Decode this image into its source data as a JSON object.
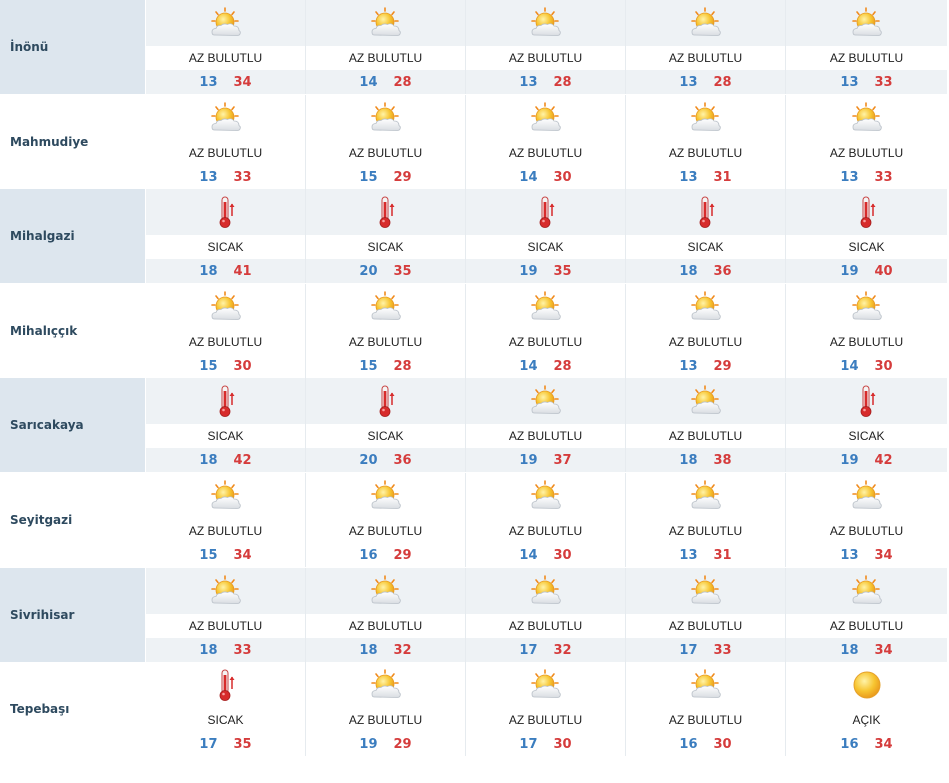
{
  "colors": {
    "min_temp": "#3b7dbf",
    "max_temp": "#d53c3c",
    "label_cell": "#dde6ee",
    "stripe": "#eef2f5"
  },
  "rows": [
    {
      "name": "İnönü",
      "days": [
        {
          "icon": "partly-cloudy-icon",
          "cond": "AZ BULUTLU",
          "min": "13",
          "max": "34"
        },
        {
          "icon": "partly-cloudy-icon",
          "cond": "AZ BULUTLU",
          "min": "14",
          "max": "28"
        },
        {
          "icon": "partly-cloudy-icon",
          "cond": "AZ BULUTLU",
          "min": "13",
          "max": "28"
        },
        {
          "icon": "partly-cloudy-icon",
          "cond": "AZ BULUTLU",
          "min": "13",
          "max": "28"
        },
        {
          "icon": "partly-cloudy-icon",
          "cond": "AZ BULUTLU",
          "min": "13",
          "max": "33"
        }
      ]
    },
    {
      "name": "Mahmudiye",
      "days": [
        {
          "icon": "partly-cloudy-icon",
          "cond": "AZ BULUTLU",
          "min": "13",
          "max": "33"
        },
        {
          "icon": "partly-cloudy-icon",
          "cond": "AZ BULUTLU",
          "min": "15",
          "max": "29"
        },
        {
          "icon": "partly-cloudy-icon",
          "cond": "AZ BULUTLU",
          "min": "14",
          "max": "30"
        },
        {
          "icon": "partly-cloudy-icon",
          "cond": "AZ BULUTLU",
          "min": "13",
          "max": "31"
        },
        {
          "icon": "partly-cloudy-icon",
          "cond": "AZ BULUTLU",
          "min": "13",
          "max": "33"
        }
      ]
    },
    {
      "name": "Mihalgazi",
      "days": [
        {
          "icon": "thermometer-hot-icon",
          "cond": "SICAK",
          "min": "18",
          "max": "41"
        },
        {
          "icon": "thermometer-hot-icon",
          "cond": "SICAK",
          "min": "20",
          "max": "35"
        },
        {
          "icon": "thermometer-hot-icon",
          "cond": "SICAK",
          "min": "19",
          "max": "35"
        },
        {
          "icon": "thermometer-hot-icon",
          "cond": "SICAK",
          "min": "18",
          "max": "36"
        },
        {
          "icon": "thermometer-hot-icon",
          "cond": "SICAK",
          "min": "19",
          "max": "40"
        }
      ]
    },
    {
      "name": "Mihalıççık",
      "days": [
        {
          "icon": "partly-cloudy-icon",
          "cond": "AZ BULUTLU",
          "min": "15",
          "max": "30"
        },
        {
          "icon": "partly-cloudy-icon",
          "cond": "AZ BULUTLU",
          "min": "15",
          "max": "28"
        },
        {
          "icon": "partly-cloudy-icon",
          "cond": "AZ BULUTLU",
          "min": "14",
          "max": "28"
        },
        {
          "icon": "partly-cloudy-icon",
          "cond": "AZ BULUTLU",
          "min": "13",
          "max": "29"
        },
        {
          "icon": "partly-cloudy-icon",
          "cond": "AZ BULUTLU",
          "min": "14",
          "max": "30"
        }
      ]
    },
    {
      "name": "Sarıcakaya",
      "days": [
        {
          "icon": "thermometer-hot-icon",
          "cond": "SICAK",
          "min": "18",
          "max": "42"
        },
        {
          "icon": "thermometer-hot-icon",
          "cond": "SICAK",
          "min": "20",
          "max": "36"
        },
        {
          "icon": "partly-cloudy-icon",
          "cond": "AZ BULUTLU",
          "min": "19",
          "max": "37"
        },
        {
          "icon": "partly-cloudy-icon",
          "cond": "AZ BULUTLU",
          "min": "18",
          "max": "38"
        },
        {
          "icon": "thermometer-hot-icon",
          "cond": "SICAK",
          "min": "19",
          "max": "42"
        }
      ]
    },
    {
      "name": "Seyitgazi",
      "days": [
        {
          "icon": "partly-cloudy-icon",
          "cond": "AZ BULUTLU",
          "min": "15",
          "max": "34"
        },
        {
          "icon": "partly-cloudy-icon",
          "cond": "AZ BULUTLU",
          "min": "16",
          "max": "29"
        },
        {
          "icon": "partly-cloudy-icon",
          "cond": "AZ BULUTLU",
          "min": "14",
          "max": "30"
        },
        {
          "icon": "partly-cloudy-icon",
          "cond": "AZ BULUTLU",
          "min": "13",
          "max": "31"
        },
        {
          "icon": "partly-cloudy-icon",
          "cond": "AZ BULUTLU",
          "min": "13",
          "max": "34"
        }
      ]
    },
    {
      "name": "Sivrihisar",
      "days": [
        {
          "icon": "partly-cloudy-icon",
          "cond": "AZ BULUTLU",
          "min": "18",
          "max": "33"
        },
        {
          "icon": "partly-cloudy-icon",
          "cond": "AZ BULUTLU",
          "min": "18",
          "max": "32"
        },
        {
          "icon": "partly-cloudy-icon",
          "cond": "AZ BULUTLU",
          "min": "17",
          "max": "32"
        },
        {
          "icon": "partly-cloudy-icon",
          "cond": "AZ BULUTLU",
          "min": "17",
          "max": "33"
        },
        {
          "icon": "partly-cloudy-icon",
          "cond": "AZ BULUTLU",
          "min": "18",
          "max": "34"
        }
      ]
    },
    {
      "name": "Tepebaşı",
      "days": [
        {
          "icon": "thermometer-hot-icon",
          "cond": "SICAK",
          "min": "17",
          "max": "35"
        },
        {
          "icon": "partly-cloudy-icon",
          "cond": "AZ BULUTLU",
          "min": "19",
          "max": "29"
        },
        {
          "icon": "partly-cloudy-icon",
          "cond": "AZ BULUTLU",
          "min": "17",
          "max": "30"
        },
        {
          "icon": "partly-cloudy-icon",
          "cond": "AZ BULUTLU",
          "min": "16",
          "max": "30"
        },
        {
          "icon": "sun-icon",
          "cond": "AÇIK",
          "min": "16",
          "max": "34"
        }
      ]
    }
  ]
}
